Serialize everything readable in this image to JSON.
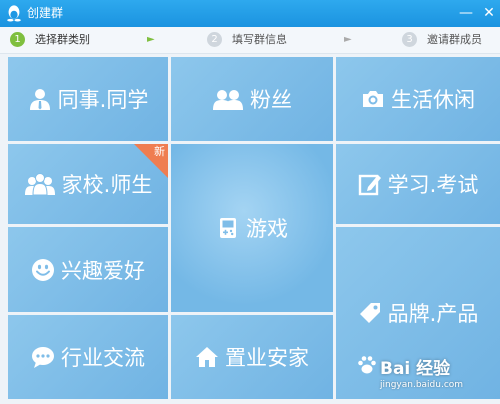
{
  "window": {
    "title": "创建群",
    "minimize": "—",
    "close": "✕"
  },
  "steps": [
    {
      "num": "1",
      "label": "选择群类别"
    },
    {
      "num": "2",
      "label": "填写群信息"
    },
    {
      "num": "3",
      "label": "邀请群成员"
    }
  ],
  "step_arrow": "►",
  "tiles": {
    "colleague": "同事.同学",
    "fans": "粉丝",
    "life": "生活休闲",
    "school": "家校.师生",
    "school_badge": "新",
    "game": "游戏",
    "study": "学习.考试",
    "hobby": "兴趣爱好",
    "brand": "品牌.产品",
    "industry": "行业交流",
    "home": "置业安家"
  },
  "watermark": {
    "logo": "Bai 经验",
    "url": "jingyan.baidu.com"
  },
  "colors": {
    "accent": "#1e98e4",
    "tile": "#7fbde8",
    "active_step": "#7fbf3f",
    "badge": "#ef7d51"
  }
}
